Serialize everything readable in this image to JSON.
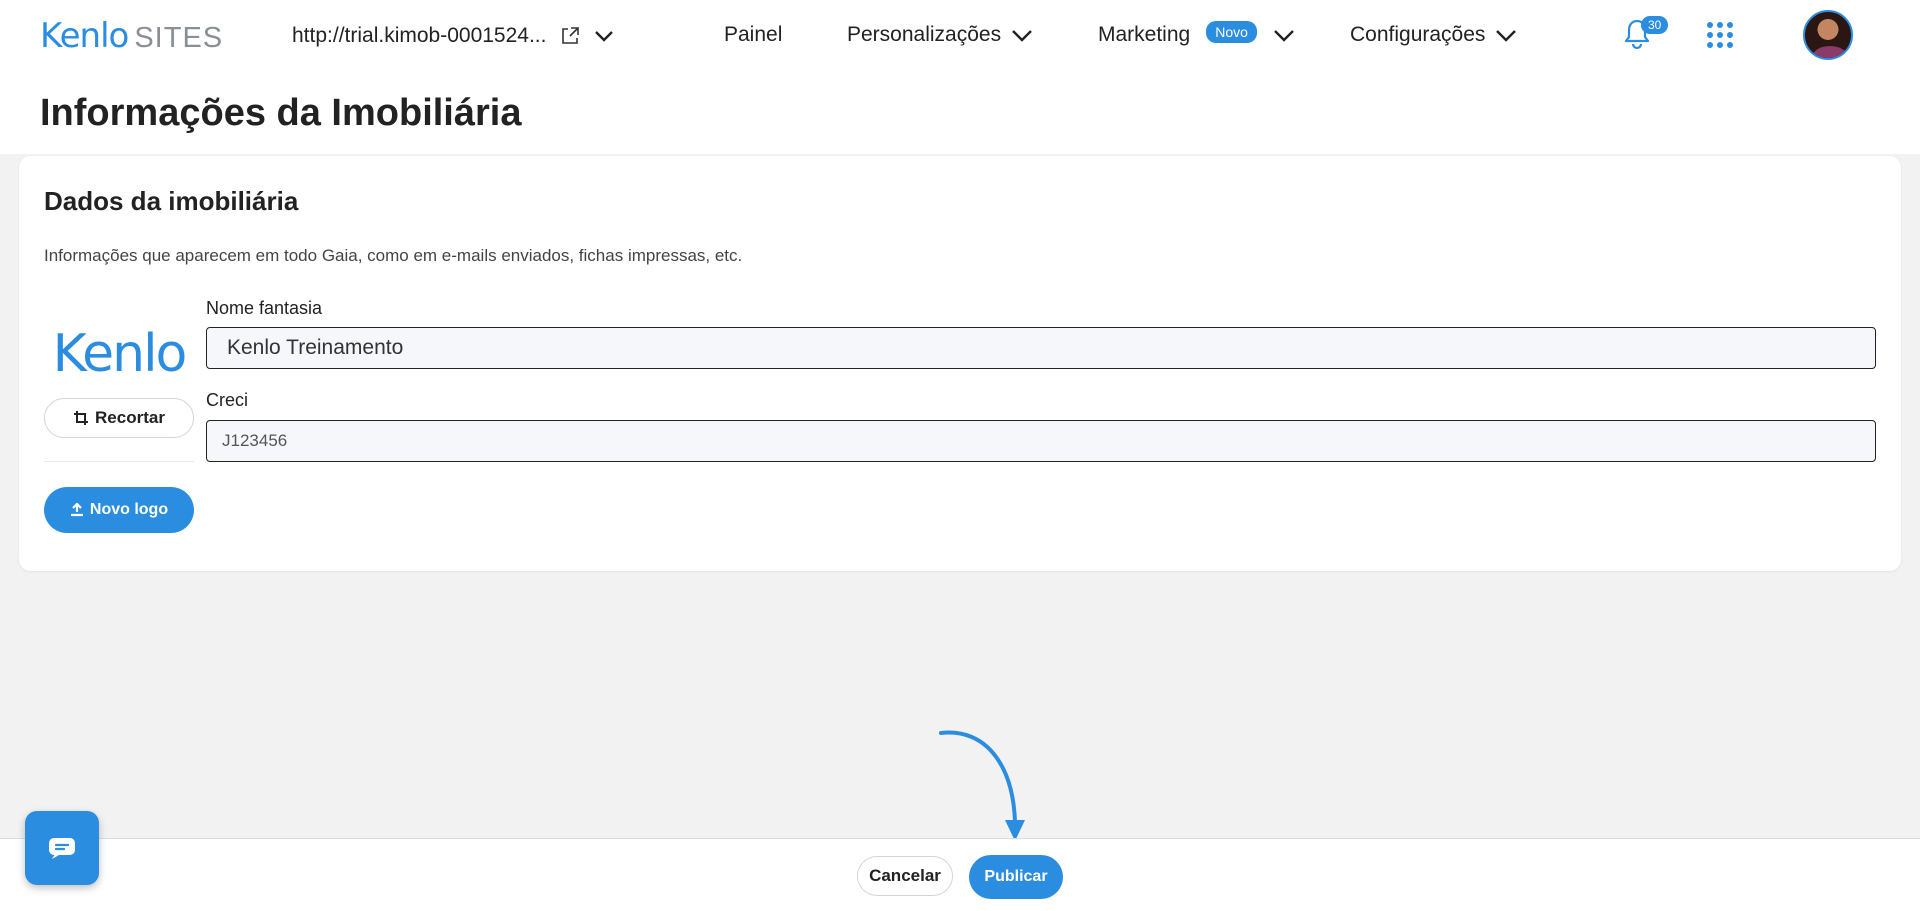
{
  "header": {
    "brand": "Kenlo",
    "brand_suffix": "SITES",
    "site_url": "http://trial.kimob-0001524...",
    "nav": {
      "painel": "Painel",
      "personalizacoes": "Personalizações",
      "marketing": "Marketing",
      "marketing_badge": "Novo",
      "configuracoes": "Configurações"
    },
    "notification_count": "30"
  },
  "page": {
    "title": "Informações da Imobiliária"
  },
  "card": {
    "title": "Dados da imobiliária",
    "description": "Informações que aparecem em todo Gaia, como em e-mails enviados, fichas impressas, etc.",
    "logo_text": "Kenlo",
    "crop_button": "Recortar",
    "new_logo_button": "Novo logo",
    "fields": {
      "nome_label": "Nome fantasia",
      "nome_value": "Kenlo Treinamento",
      "creci_label": "Creci",
      "creci_value": "J123456"
    }
  },
  "actions": {
    "cancel": "Cancelar",
    "publish": "Publicar"
  },
  "colors": {
    "accent": "#2b8de0"
  }
}
